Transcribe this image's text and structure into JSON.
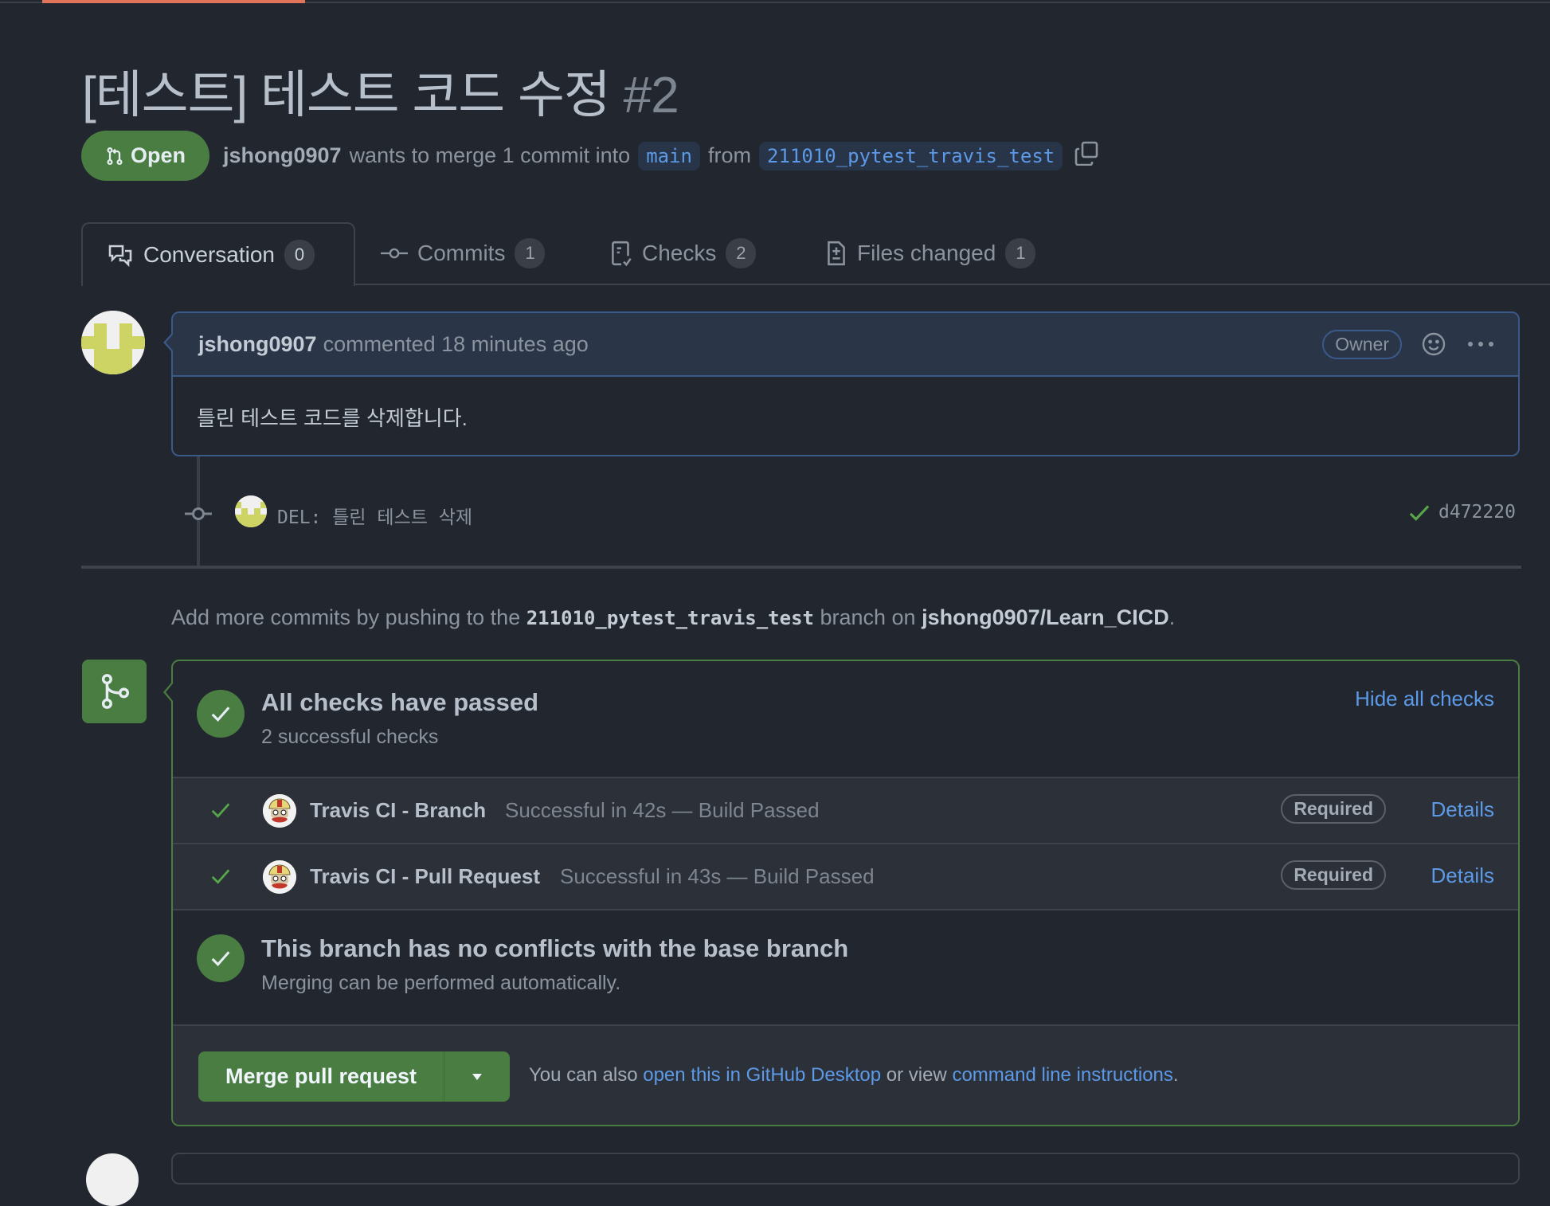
{
  "pr": {
    "title": "[테스트] 테스트 코드 수정",
    "number": "#2",
    "state": "Open",
    "author": "jshong0907",
    "merge_text": "wants to merge 1 commit into",
    "base_branch": "main",
    "from_text": "from",
    "head_branch": "211010_pytest_travis_test"
  },
  "tabs": [
    {
      "label": "Conversation",
      "count": "0",
      "icon": "comment-discussion-icon",
      "active": true
    },
    {
      "label": "Commits",
      "count": "1",
      "icon": "git-commit-icon",
      "active": false
    },
    {
      "label": "Checks",
      "count": "2",
      "icon": "checklist-icon",
      "active": false
    },
    {
      "label": "Files changed",
      "count": "1",
      "icon": "file-diff-icon",
      "active": false
    }
  ],
  "comment": {
    "author": "jshong0907",
    "action": "commented 18 minutes ago",
    "badge": "Owner",
    "body": "틀린 테스트 코드를 삭제합니다."
  },
  "commit": {
    "message": "DEL: 틀린 테스트 삭제",
    "sha": "d472220",
    "status": "success"
  },
  "push_note": {
    "prefix": "Add more commits by pushing to the",
    "branch": "211010_pytest_travis_test",
    "middle": "branch on",
    "repo": "jshong0907/Learn_CICD",
    "suffix": "."
  },
  "checks": {
    "title": "All checks have passed",
    "subtitle": "2 successful checks",
    "toggle_label": "Hide all checks",
    "items": [
      {
        "name": "Travis CI - Branch",
        "description": "Successful in 42s — Build Passed",
        "badge": "Required",
        "link": "Details"
      },
      {
        "name": "Travis CI - Pull Request",
        "description": "Successful in 43s — Build Passed",
        "badge": "Required",
        "link": "Details"
      }
    ]
  },
  "conflicts": {
    "title": "This branch has no conflicts with the base branch",
    "subtitle": "Merging can be performed automatically."
  },
  "merge": {
    "button_label": "Merge pull request",
    "note_prefix": "You can also",
    "desktop_link": "open this in GitHub Desktop",
    "note_middle": "or view",
    "cli_link": "command line instructions",
    "note_suffix": "."
  },
  "colors": {
    "success": "#4a7d41",
    "link": "#5c9ae8",
    "background": "#22262e",
    "accent_tab": "#e0755b"
  }
}
